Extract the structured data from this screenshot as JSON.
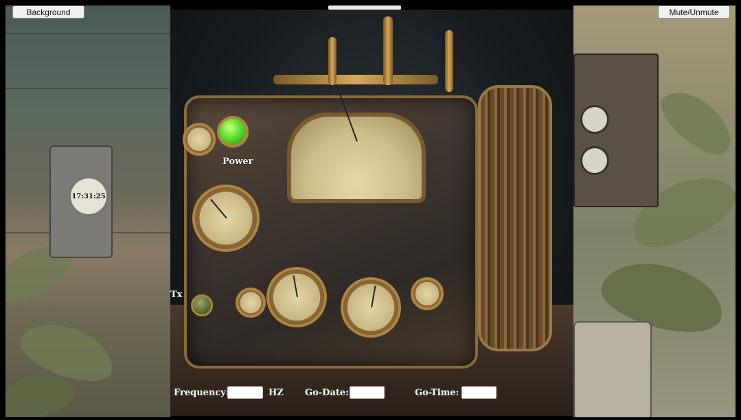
{
  "header": {
    "background_button": "Background",
    "mute_button": "Mute/Unmute"
  },
  "clock": {
    "time": "17:31:25"
  },
  "radio": {
    "power_label": "Power",
    "tx_label": "Tx",
    "power_led_color": "#5ae02a",
    "tx_led_color": "#5a6a30"
  },
  "controls": {
    "frequency_label": "Frequency:",
    "frequency_value": "",
    "frequency_unit": "HZ",
    "go_date_label": "Go-Date:",
    "go_date_value": "",
    "go_time_label": "Go-Time:",
    "go_time_value": ""
  }
}
